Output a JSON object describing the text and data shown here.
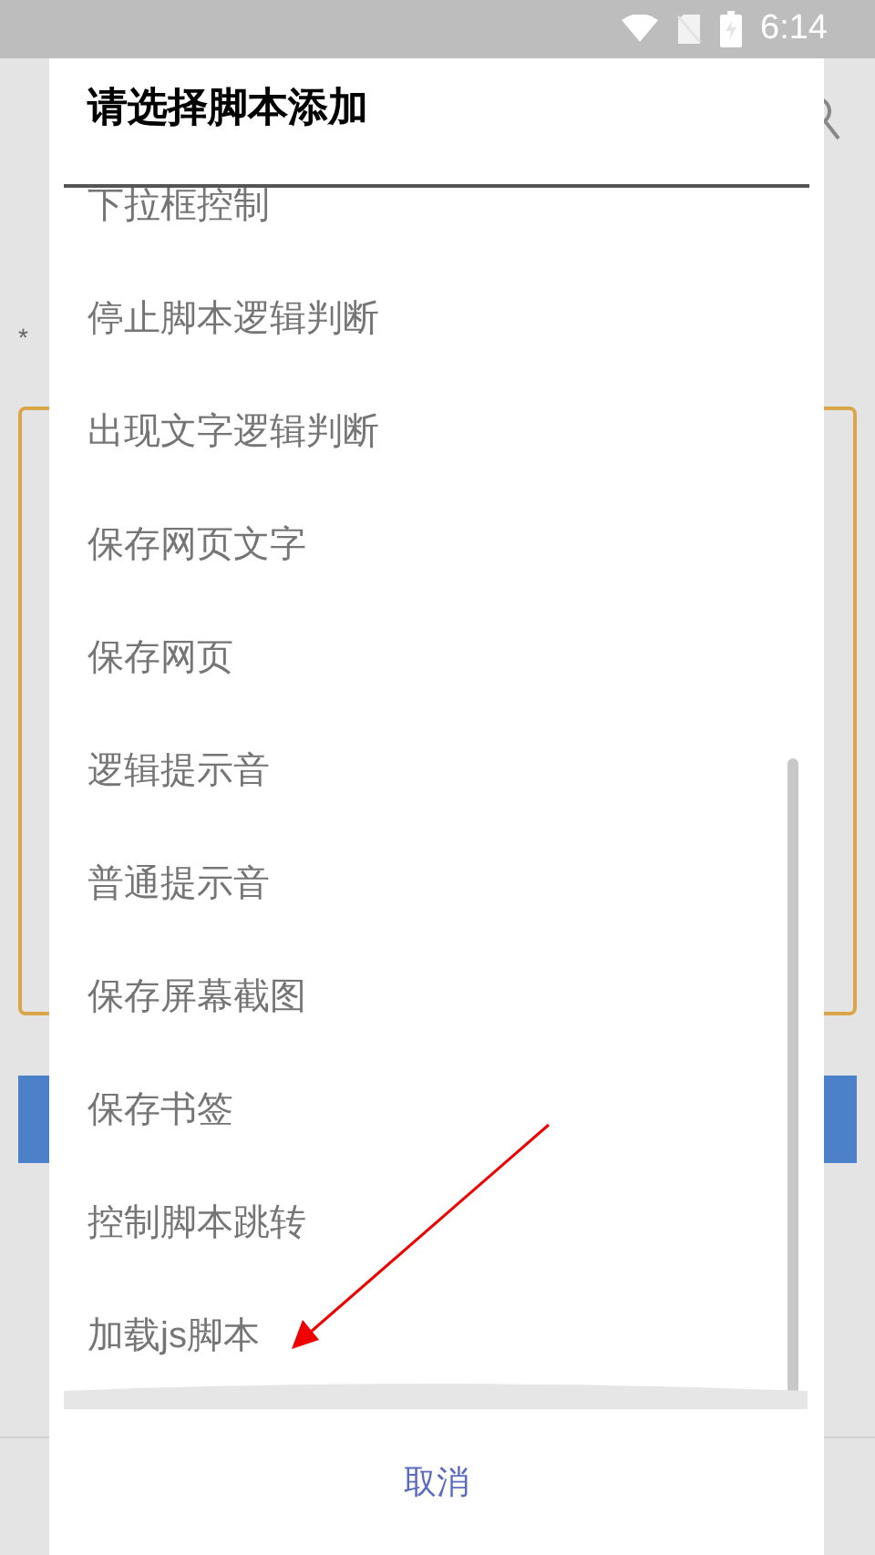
{
  "status_bar": {
    "time": "6:14"
  },
  "background": {
    "field_label": "*"
  },
  "dialog": {
    "title": "请选择脚本添加",
    "items": [
      "下拉框控制",
      "停止脚本逻辑判断",
      "出现文字逻辑判断",
      "保存网页文字",
      "保存网页",
      "逻辑提示音",
      "普通提示音",
      "保存屏幕截图",
      "保存书签",
      "控制脚本跳转",
      "加载js脚本"
    ],
    "buttons": [
      "取消"
    ]
  }
}
